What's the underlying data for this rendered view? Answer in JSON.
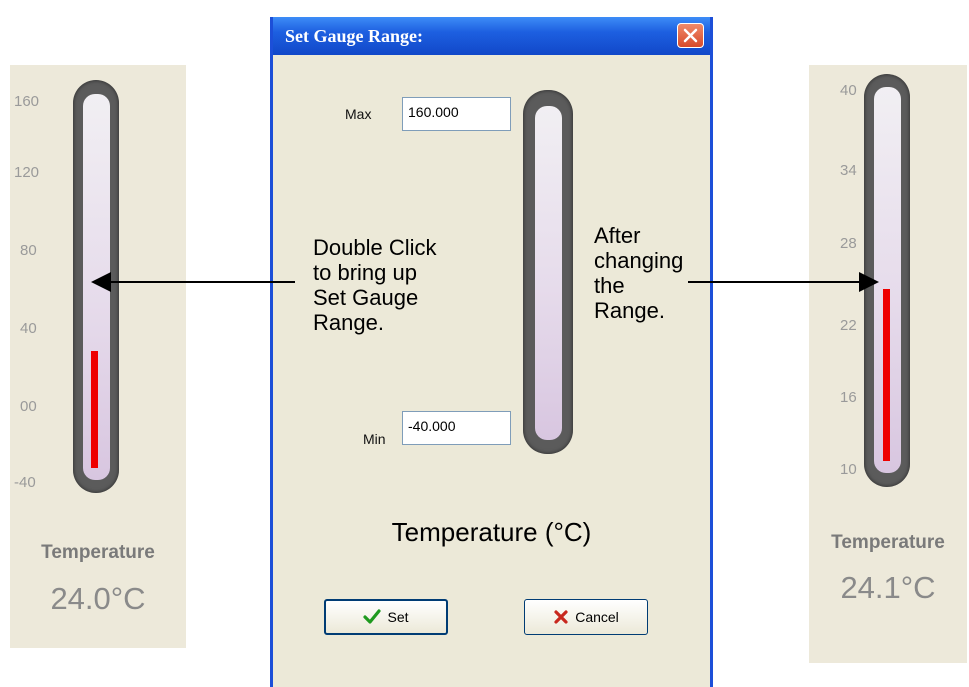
{
  "left_gauge": {
    "ticks": [
      "160",
      "120",
      "80",
      "40",
      "00",
      "-40"
    ],
    "label": "Temperature",
    "value": "24.0°C",
    "fill_fraction": 0.32
  },
  "right_gauge": {
    "ticks": [
      "40",
      "34",
      "28",
      "22",
      "16",
      "10"
    ],
    "label": "Temperature",
    "value": "24.1°C",
    "fill_fraction": 0.47
  },
  "dialog": {
    "title": "Set Gauge Range:",
    "close_icon": "close-icon",
    "max_label": "Max",
    "max_value": "160.000",
    "min_label": "Min",
    "min_value": "-40.000",
    "heading": "Temperature (°C)",
    "set_label": "Set",
    "cancel_label": "Cancel"
  },
  "annotations": {
    "left": [
      "Double Click",
      "to bring up",
      "Set Gauge",
      "Range."
    ],
    "right": [
      "After",
      "changing",
      "the",
      "Range."
    ]
  },
  "colors": {
    "panel_bg": "#ede9da",
    "titlebar": "#1d5fe0",
    "fill": "#ee0000",
    "tube": "#5b5b5b"
  }
}
